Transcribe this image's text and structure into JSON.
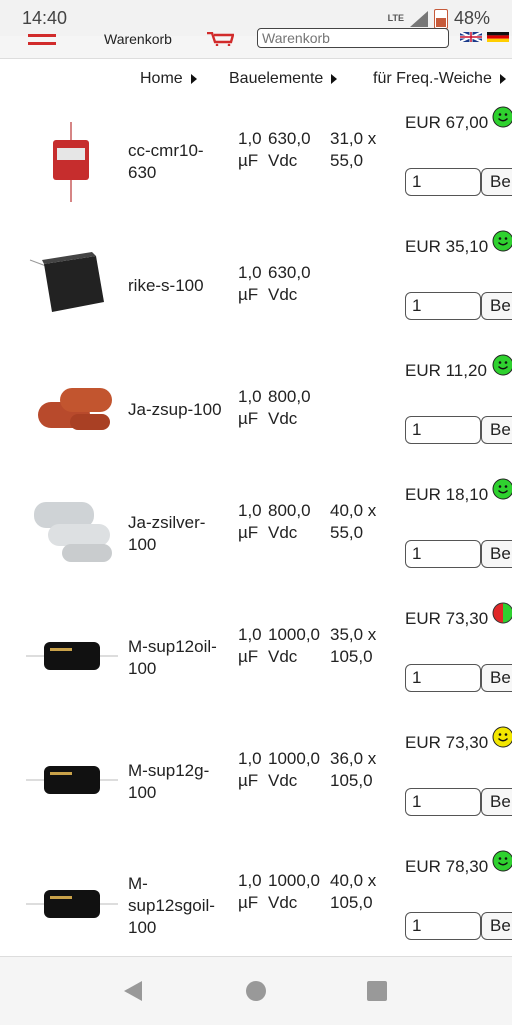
{
  "status": {
    "time": "14:40",
    "network": "LTE",
    "battery": "48%"
  },
  "header": {
    "cart_label": "Warenkorb",
    "search_placeholder": "Warenkorb"
  },
  "breadcrumb": [
    "Home",
    "Bauelemente",
    "für Freq.-Weiche"
  ],
  "products": [
    {
      "name_lines": [
        "cc-cmr10-",
        "630"
      ],
      "cap_lines": [
        "1,0",
        "µF"
      ],
      "volt_lines": [
        "630,0",
        "Vdc"
      ],
      "dim_lines": [
        "31,0 x",
        "55,0"
      ],
      "price": "EUR 67,00",
      "qty": "1",
      "buy": "Be",
      "stock": "green-smiley"
    },
    {
      "name_lines": [
        "rike-s-100"
      ],
      "cap_lines": [
        "1,0",
        "µF"
      ],
      "volt_lines": [
        "630,0",
        "Vdc"
      ],
      "dim_lines": [],
      "price": "EUR 35,10",
      "qty": "1",
      "buy": "Be",
      "stock": "green-smiley"
    },
    {
      "name_lines": [
        "Ja-zsup-100"
      ],
      "cap_lines": [
        "1,0",
        "µF"
      ],
      "volt_lines": [
        "800,0",
        "Vdc"
      ],
      "dim_lines": [],
      "price": "EUR 11,20",
      "qty": "1",
      "buy": "Be",
      "stock": "green-smiley"
    },
    {
      "name_lines": [
        "Ja-zsilver-",
        "100"
      ],
      "cap_lines": [
        "1,0",
        "µF"
      ],
      "volt_lines": [
        "800,0",
        "Vdc"
      ],
      "dim_lines": [
        "40,0 x",
        "55,0"
      ],
      "price": "EUR 18,10",
      "qty": "1",
      "buy": "Be",
      "stock": "green-smiley"
    },
    {
      "name_lines": [
        "M-sup12oil-",
        "100"
      ],
      "cap_lines": [
        "1,0",
        "µF"
      ],
      "volt_lines": [
        "1000,0",
        "Vdc"
      ],
      "dim_lines": [
        "35,0 x",
        "105,0"
      ],
      "price": "EUR 73,30",
      "qty": "1",
      "buy": "Be",
      "stock": "red-green-badge"
    },
    {
      "name_lines": [
        "M-sup12g-",
        "100"
      ],
      "cap_lines": [
        "1,0",
        "µF"
      ],
      "volt_lines": [
        "1000,0",
        "Vdc"
      ],
      "dim_lines": [
        "36,0 x",
        "105,0"
      ],
      "price": "EUR 73,30",
      "qty": "1",
      "buy": "Be",
      "stock": "yellow-smiley"
    },
    {
      "name_lines": [
        "M-",
        "sup12sgoil-",
        "100"
      ],
      "cap_lines": [
        "1,0",
        "µF"
      ],
      "volt_lines": [
        "1000,0",
        "Vdc"
      ],
      "dim_lines": [
        "40,0 x",
        "105,0"
      ],
      "price": "EUR 78,30",
      "qty": "1",
      "buy": "Be",
      "stock": "green-smiley"
    }
  ],
  "colors": {
    "accent_red": "#d12b2b",
    "smiley_green": "#2fd12f",
    "smiley_yellow": "#f2e600"
  },
  "icons": [
    "hamburger-icon",
    "cart-icon",
    "uk-flag-icon",
    "de-flag-icon",
    "back-icon",
    "home-icon",
    "recents-icon"
  ]
}
